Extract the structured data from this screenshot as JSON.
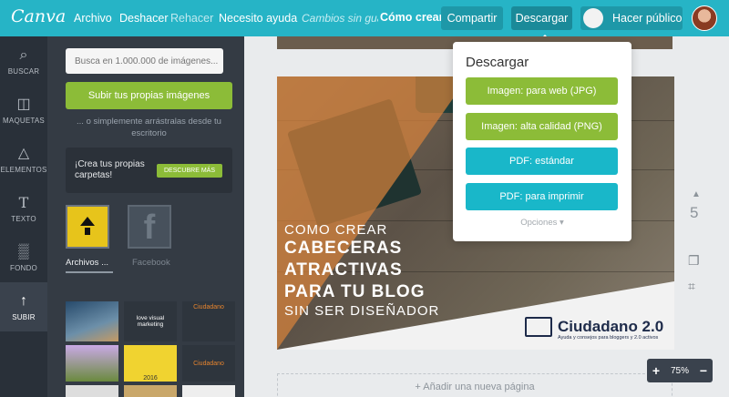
{
  "app": {
    "logo": "Canva"
  },
  "menu": {
    "archivo": "Archivo",
    "deshacer": "Deshacer",
    "rehacer": "Rehacer",
    "ayuda": "Necesito ayuda",
    "saved_status": "Cambios sin guardar",
    "como_crear": "Cómo crear",
    "compartir": "Compartir",
    "descargar": "Descargar",
    "hacer_publico": "Hacer público"
  },
  "rail": [
    {
      "label": "BUSCAR",
      "icon": "search-icon"
    },
    {
      "label": "MAQUETAS",
      "icon": "layout-icon"
    },
    {
      "label": "ELEMENTOS",
      "icon": "shapes-icon"
    },
    {
      "label": "TEXTO",
      "icon": "text-icon"
    },
    {
      "label": "FONDO",
      "icon": "background-icon"
    },
    {
      "label": "SUBIR",
      "icon": "upload-icon"
    }
  ],
  "panel": {
    "search_placeholder": "Busca en 1.000.000 de imágenes...",
    "upload_button": "Subir tus propias imágenes",
    "drag_text": "... o simplemente arrástralas desde tu escritorio",
    "folders_promo": "¡Crea tus propias carpetas!",
    "descubre": "DESCUBRE MÁS",
    "tab_archivos": "Archivos ...",
    "tab_facebook": "Facebook",
    "thumb_labels": [
      "Ciudadano",
      "love visual marketing",
      "Ciudadano",
      "2016"
    ]
  },
  "design": {
    "line1": "COMO CREAR",
    "line2": "CABECERAS",
    "line3": "ATRACTIVAS",
    "line4": "PARA TU BLOG",
    "line5": "SIN SER DISEÑADOR",
    "brand": "Ciudadano 2.0",
    "brand_sub": "Ayuda y consejos para bloggers y 2.0 activos"
  },
  "canvas": {
    "add_page": "+ Añadir una nueva página",
    "page_number": "5",
    "zoom": "75%"
  },
  "download_menu": {
    "title": "Descargar",
    "options": [
      "Imagen: para web (JPG)",
      "Imagen: alta calidad (PNG)",
      "PDF: estándar",
      "PDF: para imprimir"
    ],
    "more": "Opciones"
  },
  "colors": {
    "topbar": "#26b4c6",
    "green": "#8cbc38",
    "teal": "#19b7c9",
    "sidebar": "#343b44"
  }
}
